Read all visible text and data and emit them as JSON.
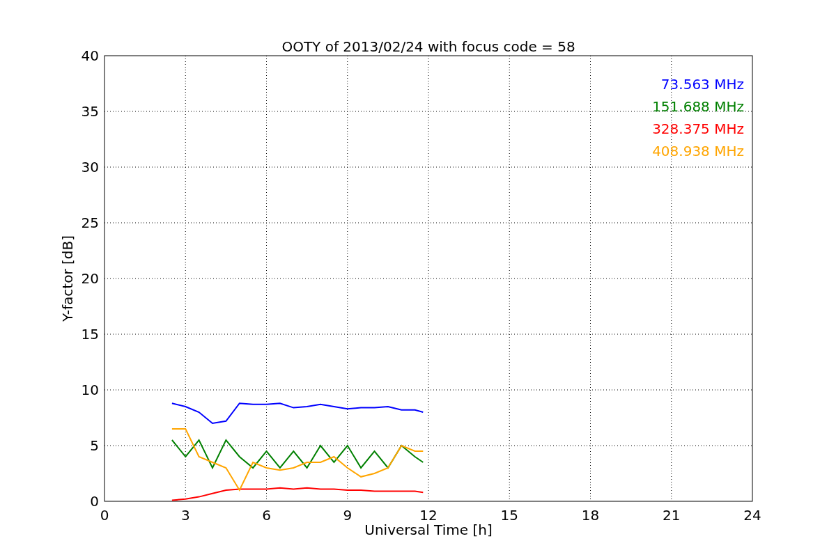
{
  "chart_data": {
    "type": "line",
    "title": "OOTY of 2013/02/24 with focus code = 58",
    "xlabel": "Universal Time [h]",
    "ylabel": "Y-factor [dB]",
    "x": [
      2.5,
      3,
      3.5,
      4,
      4.5,
      5,
      5.5,
      6,
      6.5,
      7,
      7.5,
      8,
      8.5,
      9,
      9.5,
      10,
      10.5,
      11,
      11.5,
      11.8
    ],
    "series": [
      {
        "name": "73.563 MHz",
        "color": "#0000ff",
        "values": [
          8.8,
          8.5,
          8.0,
          7.0,
          7.2,
          8.8,
          8.7,
          8.7,
          8.8,
          8.4,
          8.5,
          8.7,
          8.5,
          8.3,
          8.4,
          8.4,
          8.5,
          8.2,
          8.2,
          8.0
        ]
      },
      {
        "name": "151.688 MHz",
        "color": "#008000",
        "values": [
          5.5,
          4,
          5.5,
          3,
          5.5,
          4,
          3,
          4.5,
          3,
          4.5,
          3,
          5,
          3.5,
          5,
          3,
          4.5,
          3,
          5,
          4,
          3.5
        ]
      },
      {
        "name": "328.375 MHz",
        "color": "#ff0000",
        "values": [
          0.1,
          0.2,
          0.4,
          0.7,
          1.0,
          1.1,
          1.1,
          1.1,
          1.2,
          1.1,
          1.2,
          1.1,
          1.1,
          1.0,
          1.0,
          0.9,
          0.9,
          0.9,
          0.9,
          0.8
        ]
      },
      {
        "name": "408.938 MHz",
        "color": "#ffa500",
        "values": [
          6.5,
          6.5,
          4,
          3.5,
          3,
          1,
          3.5,
          3,
          2.8,
          3,
          3.5,
          3.5,
          4,
          3,
          2.2,
          2.5,
          3,
          5,
          4.5,
          4.5
        ]
      }
    ],
    "grid": true,
    "xlim": [
      0,
      24
    ],
    "ylim": [
      0,
      40
    ],
    "xticks": [
      0,
      3,
      6,
      9,
      12,
      15,
      18,
      21,
      24
    ],
    "yticks": [
      0,
      5,
      10,
      15,
      20,
      25,
      30,
      35,
      40
    ]
  }
}
